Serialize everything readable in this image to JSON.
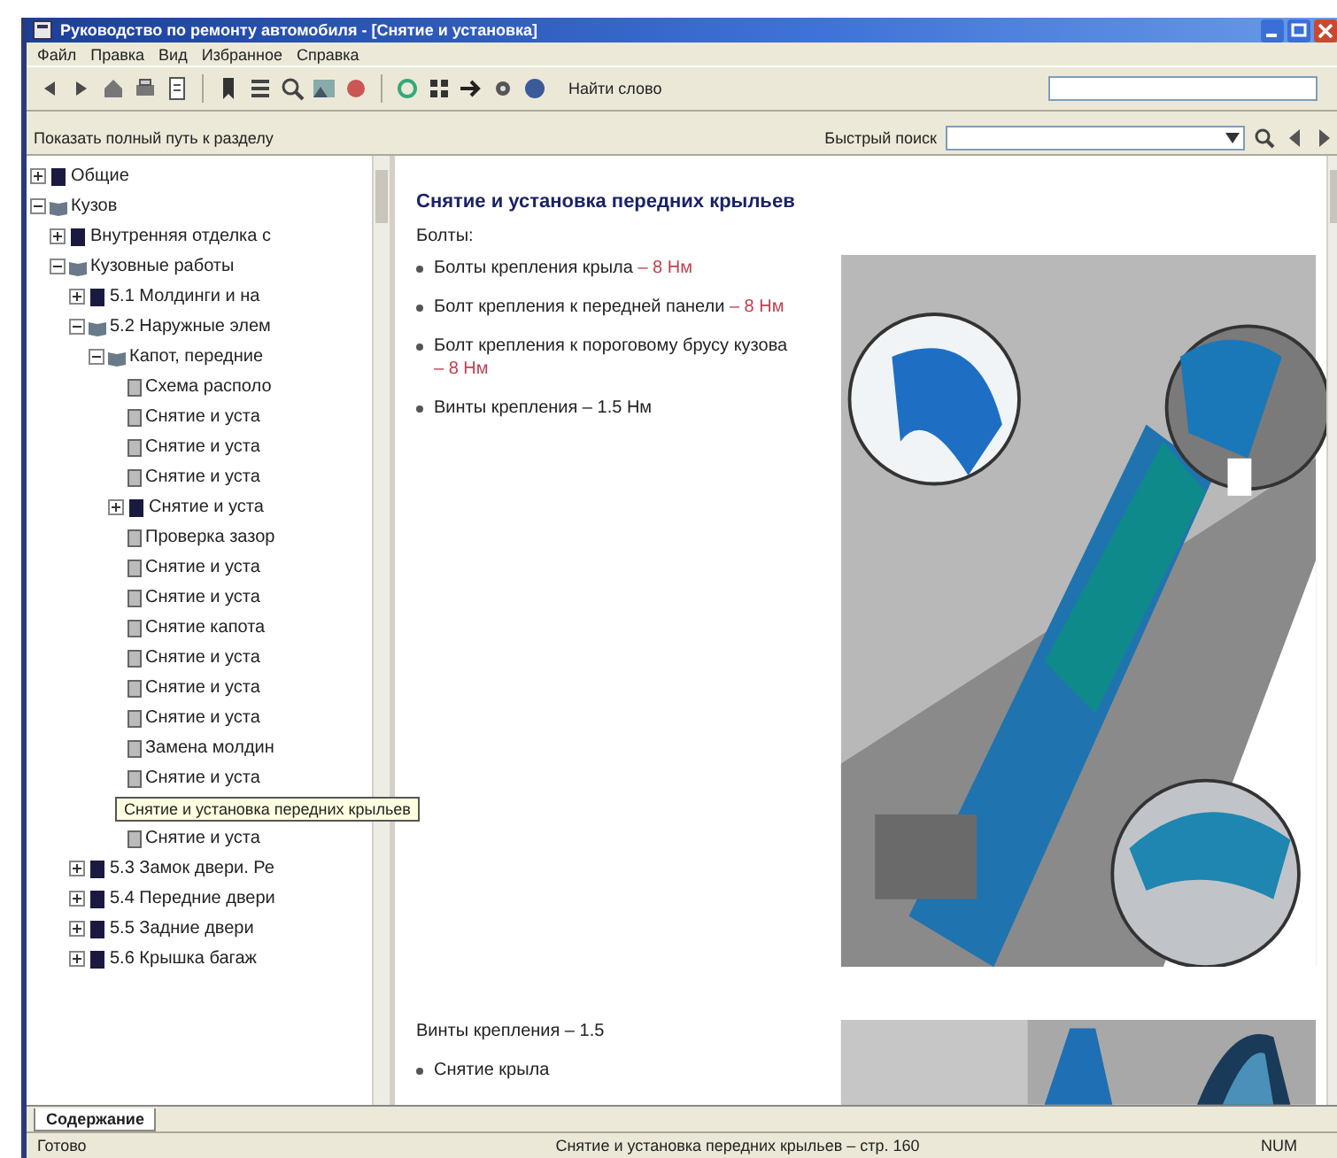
{
  "window": {
    "title": "Руководство по ремонту автомобиля - [Снятие и установка]"
  },
  "menu": [
    "Файл",
    "Правка",
    "Вид",
    "Избранное",
    "Справка"
  ],
  "toolbar": {
    "search_label": "Найти слово"
  },
  "pathbar": {
    "label": "Показать полный путь к разделу",
    "search_label": "Быстрый поиск"
  },
  "tree": [
    {
      "label": "Общие",
      "expanded": false
    },
    {
      "label": "Кузов",
      "expanded": true,
      "children": [
        {
          "label": "Внутренняя отделка с",
          "expanded": false
        },
        {
          "label": "Кузовные работы",
          "expanded": true,
          "children": [
            {
              "label": "5.1 Молдинги и на",
              "expanded": false
            },
            {
              "label": "5.2 Наружные элем",
              "expanded": true,
              "children": [
                {
                  "label": "Капот, передние",
                  "expanded": true,
                  "children": [
                    {
                      "label": "Схема располо",
                      "hovered": false
                    },
                    {
                      "label": "Снятие и уста",
                      "hovered": false
                    },
                    {
                      "label": "Снятие и уста",
                      "hovered": false
                    },
                    {
                      "label": "Снятие и уста",
                      "hovered": false
                    },
                    {
                      "label": "Снятие и уста",
                      "hovered": false,
                      "expanded": false
                    },
                    {
                      "label": "Проверка зазор",
                      "hovered": false
                    },
                    {
                      "label": "Снятие и уста",
                      "hovered": false
                    },
                    {
                      "label": "Снятие и уста",
                      "hovered": false
                    },
                    {
                      "label": "Снятие капота",
                      "hovered": false
                    },
                    {
                      "label": "Снятие и уста",
                      "hovered": false
                    },
                    {
                      "label": "Снятие и уста",
                      "hovered": false
                    },
                    {
                      "label": "Снятие и уста",
                      "hovered": false
                    },
                    {
                      "label": "Замена молдин",
                      "hovered": false
                    },
                    {
                      "label": "Снятие и уста",
                      "hovered": false
                    },
                    {
                      "label": "Снятие и установка передних крыльев",
                      "hovered": true
                    },
                    {
                      "label": "Снятие и уста",
                      "hovered": false
                    }
                  ]
                }
              ]
            },
            {
              "label": "5.3 Замок двери. Ре",
              "expanded": false
            },
            {
              "label": "5.4 Передние двери",
              "expanded": false
            },
            {
              "label": "5.5 Задние двери",
              "expanded": false
            },
            {
              "label": "5.6 Крышка багаж",
              "expanded": false
            }
          ]
        }
      ]
    }
  ],
  "content": {
    "heading": "Снятие и установка передних крыльев",
    "subheading": "Болты:",
    "items": [
      {
        "text": "Болты крепления крыла",
        "link": "– 8 Нм"
      },
      {
        "text": "Болт крепления к передней панели",
        "link": "– 8 Нм"
      },
      {
        "text": "Болт крепления к пороговому брусу кузова",
        "link": "– 8 Нм"
      },
      {
        "text": "Винты крепления – 1.5 Нм"
      }
    ],
    "bottom": [
      "Винты крепления – 1.5",
      "Снятие крыла"
    ]
  },
  "tabs": [
    {
      "label": "Содержание",
      "selected": true
    }
  ],
  "status_bar": [
    "Готово",
    "Снятие и установка передних крыльев – стр. 160",
    "NUM"
  ]
}
